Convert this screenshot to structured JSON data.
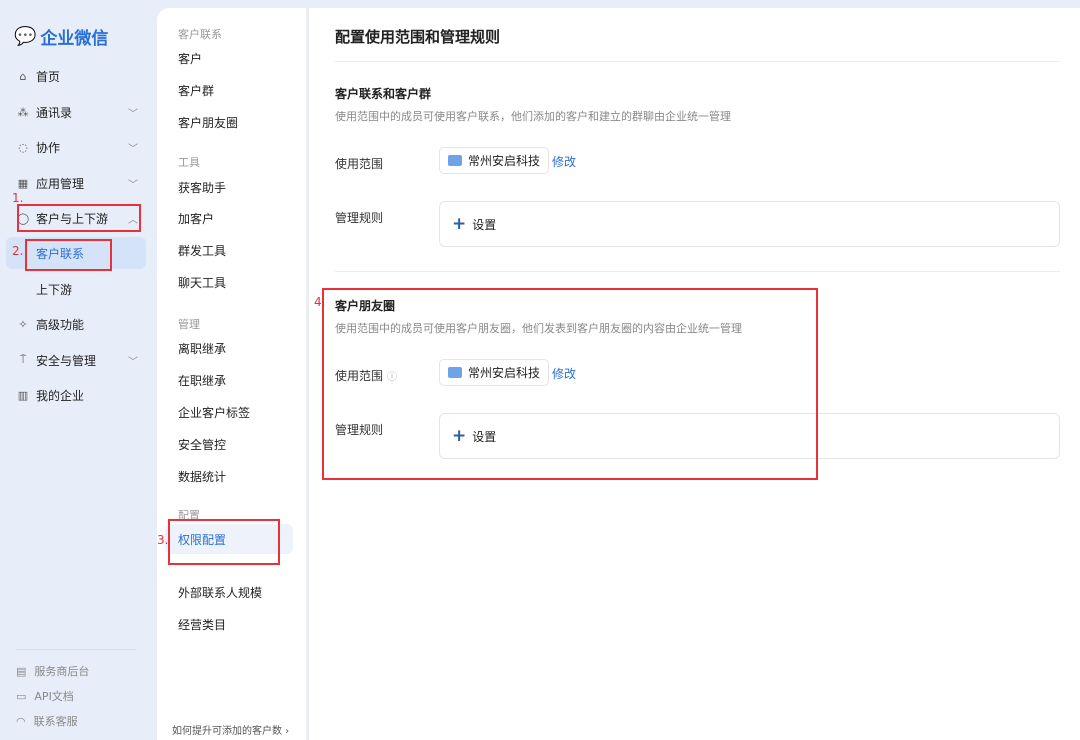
{
  "logo": "企业微信",
  "nav": [
    {
      "label": "首页",
      "icon": "home-icon",
      "glyph": "⌂"
    },
    {
      "label": "通讯录",
      "icon": "org-chart-icon",
      "glyph": "⁂"
    },
    {
      "label": "协作",
      "icon": "collab-icon",
      "glyph": "◌"
    },
    {
      "label": "应用管理",
      "icon": "apps-grid-icon",
      "glyph": "▦"
    },
    {
      "label": "客户与上下游",
      "icon": "chat-bubble-icon",
      "glyph": "◯"
    },
    {
      "label": "客户联系"
    },
    {
      "label": "上下游"
    },
    {
      "label": "高级功能",
      "icon": "feature-icon",
      "glyph": "✧"
    },
    {
      "label": "安全与管理",
      "icon": "shield-icon",
      "glyph": "⍑"
    },
    {
      "label": "我的企业",
      "icon": "building-icon",
      "glyph": "▥"
    }
  ],
  "footer": [
    {
      "label": "服务商后台",
      "glyph": "▤"
    },
    {
      "label": "API文档",
      "glyph": "▭"
    },
    {
      "label": "联系客服",
      "glyph": "◠"
    }
  ],
  "submenu": {
    "groups": [
      {
        "title": "客户联系",
        "items": [
          "客户",
          "客户群",
          "客户朋友圈"
        ]
      },
      {
        "title": "工具",
        "items": [
          "获客助手",
          "加客户",
          "群发工具",
          "聊天工具"
        ]
      },
      {
        "title": "管理",
        "items": [
          "离职继承",
          "在职继承",
          "企业客户标签",
          "安全管控",
          "数据统计"
        ]
      },
      {
        "title": "配置",
        "items": [
          "权限配置",
          "外部联系人规模",
          "经营类目"
        ]
      }
    ],
    "bottom_link": "如何提升可添加的客户数 ›"
  },
  "main": {
    "title": "配置使用范围和管理规则",
    "sections": [
      {
        "title": "客户联系和客户群",
        "desc": "使用范围中的成员可使用客户联系，他们添加的客户和建立的群聊由企业统一管理",
        "scope_label": "使用范围",
        "scope_value": "常州安启科技",
        "edit": "修改",
        "rule_label": "管理规则",
        "rule_button": "设置"
      },
      {
        "title": "客户朋友圈",
        "desc": "使用范围中的成员可使用客户朋友圈，他们发表到客户朋友圈的内容由企业统一管理",
        "scope_label": "使用范围",
        "scope_value": "常州安启科技",
        "edit": "修改",
        "rule_label": "管理规则",
        "rule_button": "设置"
      }
    ]
  },
  "annotations": [
    "1.",
    "2.",
    "3.",
    "4."
  ]
}
